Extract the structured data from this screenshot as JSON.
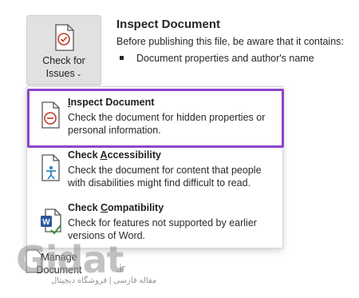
{
  "issues_button": {
    "label_line1": "Check for",
    "label_line2": "Issues",
    "chevron": "⌄",
    "icon": "document-check-icon"
  },
  "inspect_panel": {
    "title": "Inspect Document",
    "description": "Before publishing this file, be aware that it contains:",
    "bullets": [
      "Document properties and author's name"
    ]
  },
  "menu": {
    "items": [
      {
        "title_accel": "I",
        "title_rest": "nspect Document",
        "description": "Check the document for hidden properties or personal information.",
        "icon": "inspect-document-icon"
      },
      {
        "title_pre": "Check ",
        "title_accel": "A",
        "title_rest": "ccessibility",
        "description": "Check the document for content that people with disabilities might find difficult to read.",
        "icon": "accessibility-icon"
      },
      {
        "title_pre": "Check ",
        "title_accel": "C",
        "title_rest": "ompatibility",
        "description": "Check for features not supported by earlier versions of Word.",
        "icon": "compatibility-icon"
      }
    ]
  },
  "manage": {
    "label_line1": "Manage",
    "label_line2": "Document"
  },
  "watermark": {
    "brand": "Gidat",
    "tld": ".ir",
    "tagline": "مقاله فارسی | فروشگاه دیجیتال"
  },
  "colors": {
    "highlight": "#8e44c9",
    "button_bg": "#e1e1e1",
    "inspect_icon_accent": "#c0392b",
    "accessibility_accent": "#2e86c1",
    "word_blue": "#2b579a"
  }
}
